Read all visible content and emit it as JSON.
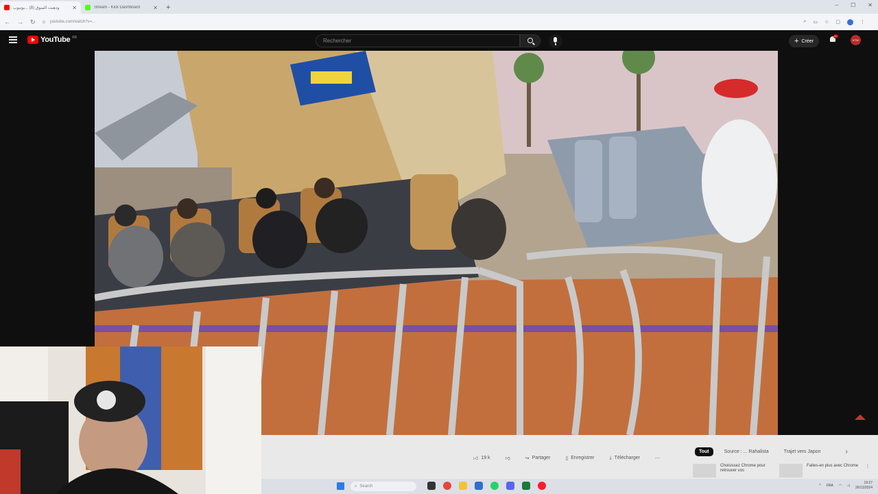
{
  "browser": {
    "tabs": [
      {
        "title": "وذهبت السوق (8) ...يوتيوب",
        "active": true,
        "favicon_color": "#ff0000"
      },
      {
        "title": "Stream - Kick Dashboard",
        "active": false,
        "favicon_color": "#53fc18"
      }
    ],
    "url": "youtube.com/watch?v=...",
    "window_controls": [
      "–",
      "☐",
      "✕"
    ]
  },
  "youtube": {
    "logo_text": "YouTube",
    "country_code": "FR",
    "search_placeholder": "Rechercher",
    "create_label": "Créer",
    "notification_count": "9+",
    "avatar_text": "KTW"
  },
  "video": {
    "scene": "amusement park roller coaster station with riders seated"
  },
  "actions": {
    "likes": "19 k",
    "share": "Partager",
    "save": "Enregistrer",
    "download": "Télécharger",
    "more": "⋯"
  },
  "chips": [
    "Tout",
    "Source : ... Rahalista",
    "Trajet vers Japon"
  ],
  "recommendations": [
    {
      "text": "Choisissez Chrome pour retrouver vos"
    },
    {
      "text": "Faites-en plus avec Chrome"
    }
  ],
  "taskbar": {
    "search_label": "Search",
    "lang": "FRA",
    "time": "19:27",
    "date": "26/12/2024"
  },
  "colors": {
    "youtube_red": "#ff0000",
    "bg_dark": "#0f0f0f",
    "accent_blue": "#3b6ed9"
  }
}
